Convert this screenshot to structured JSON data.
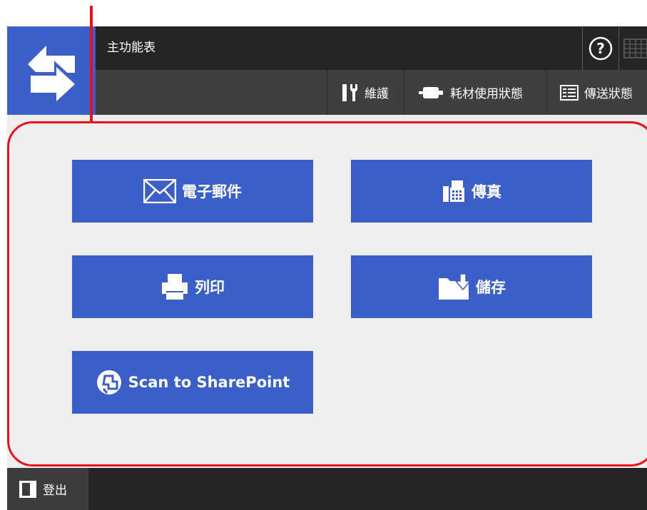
{
  "header": {
    "title": "主功能表",
    "help_icon": "help-circle-icon",
    "keyboard_icon": "keyboard-icon"
  },
  "toolbar": {
    "maintenance_label": "維護",
    "consumables_label": "耗材使用狀態",
    "transmission_label": "傳送狀態"
  },
  "main": {
    "buttons": [
      {
        "label": "電子郵件",
        "icon": "envelope-icon"
      },
      {
        "label": "傳真",
        "icon": "fax-icon"
      },
      {
        "label": "列印",
        "icon": "printer-icon"
      },
      {
        "label": "儲存",
        "icon": "save-folder-icon"
      },
      {
        "label": "Scan to SharePoint",
        "icon": "sharepoint-icon"
      }
    ]
  },
  "footer": {
    "logout_label": "登出"
  },
  "colors": {
    "accent_blue": "#3c5fc7",
    "titlebar": "#252525",
    "toolbar": "#3f3f3f",
    "callout_red": "#e8101e",
    "panel": "#eeeeee"
  }
}
